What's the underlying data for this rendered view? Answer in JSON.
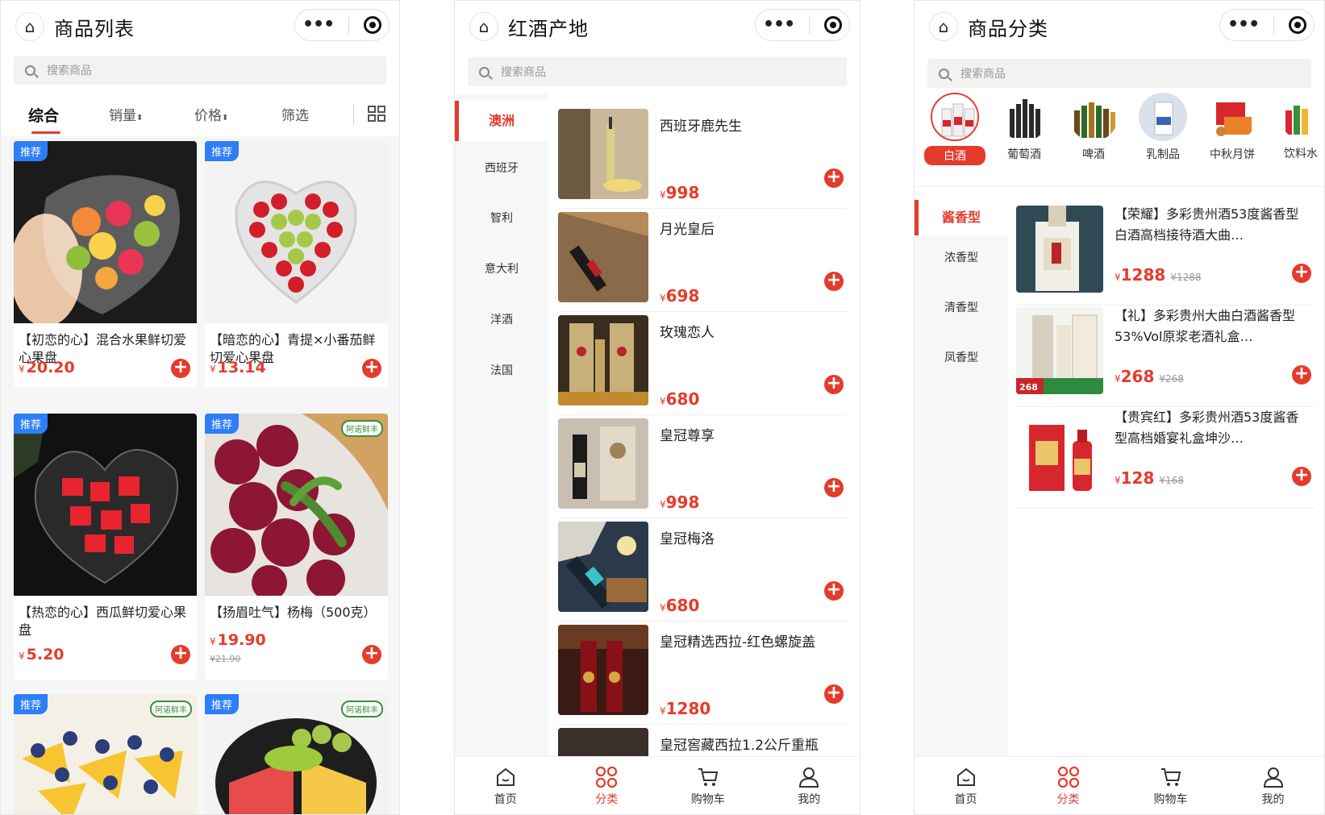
{
  "screen1": {
    "title": "商品列表",
    "search_placeholder": "搜索商品",
    "sort": {
      "comprehensive": "综合",
      "sales": "销量",
      "price": "价格",
      "filter": "筛选"
    },
    "products": [
      {
        "badge": "推荐",
        "name": "【初恋的心】混合水果鲜切爱心果盘",
        "currency": "¥",
        "price": "20.20"
      },
      {
        "badge": "推荐",
        "name": "【暗恋的心】青提×小番茄鲜切爱心果盘",
        "currency": "¥",
        "price": "13.14"
      },
      {
        "badge": "推荐",
        "name": "【热恋的心】西瓜鲜切爱心果盘",
        "currency": "¥",
        "price": "5.20"
      },
      {
        "badge": "推荐",
        "name": "【扬眉吐气】杨梅（500克）",
        "currency": "¥",
        "price": "19.90",
        "old_price": "¥21.90"
      },
      {
        "badge": "推荐"
      },
      {
        "badge": "推荐"
      }
    ]
  },
  "screen2": {
    "title": "红酒产地",
    "search_placeholder": "搜索商品",
    "regions": [
      "澳洲",
      "西班牙",
      "智利",
      "意大利",
      "洋酒",
      "法国"
    ],
    "products": [
      {
        "name": "西班牙鹿先生",
        "currency": "¥",
        "price": "998"
      },
      {
        "name": "月光皇后",
        "currency": "¥",
        "price": "698"
      },
      {
        "name": "玫瑰恋人",
        "currency": "¥",
        "price": "680"
      },
      {
        "name": "皇冠尊享",
        "currency": "¥",
        "price": "998"
      },
      {
        "name": "皇冠梅洛",
        "currency": "¥",
        "price": "680"
      },
      {
        "name": "皇冠精选西拉-红色螺旋盖",
        "currency": "¥",
        "price": "1280"
      },
      {
        "name": "皇冠窖藏西拉1.2公斤重瓶"
      }
    ],
    "tabs": [
      "首页",
      "分类",
      "购物车",
      "我的"
    ]
  },
  "screen3": {
    "title": "商品分类",
    "search_placeholder": "搜索商品",
    "categories": [
      "白酒",
      "葡萄酒",
      "啤酒",
      "乳制品",
      "中秋月饼",
      "饮料水"
    ],
    "subcategories": [
      "酱香型",
      "浓香型",
      "清香型",
      "凤香型"
    ],
    "products": [
      {
        "name": "【荣耀】多彩贵州酒53度酱香型白酒高档接待酒大曲…",
        "currency": "¥",
        "price": "1288",
        "old_price": "¥1288"
      },
      {
        "name": "【礼】多彩贵州大曲白酒酱香型53%Vol原浆老酒礼盒…",
        "currency": "¥",
        "price": "268",
        "old_price": "¥268",
        "img_tag": "268"
      },
      {
        "name": "【贵宾红】多彩贵州酒53度酱香型高档婚宴礼盒坤沙…",
        "currency": "¥",
        "price": "128",
        "old_price": "¥168"
      }
    ],
    "tabs": [
      "首页",
      "分类",
      "购物车",
      "我的"
    ]
  },
  "logo_text": "阿诺鲜丰",
  "colors": {
    "accent": "#e53b2c",
    "badge": "#2d7ef7"
  }
}
